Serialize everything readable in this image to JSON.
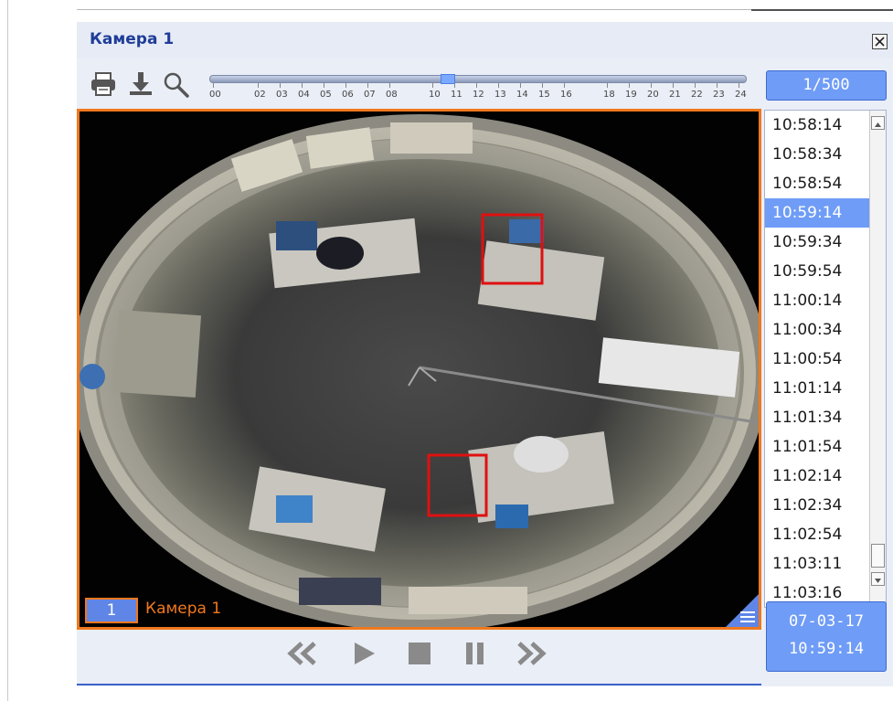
{
  "window": {
    "title": "Камера 1",
    "close_icon": "close-icon"
  },
  "toolbar": {
    "icons": [
      "print-icon",
      "download-icon",
      "search-icon"
    ],
    "counter": "1/500"
  },
  "timeline": {
    "ticks": [
      "00",
      "02",
      "03",
      "04",
      "05",
      "06",
      "07",
      "08",
      "10",
      "11",
      "12",
      "13",
      "14",
      "15",
      "16",
      "18",
      "19",
      "20",
      "21",
      "22",
      "23",
      "24"
    ],
    "position_fraction": 0.45
  },
  "camera": {
    "number": "1",
    "label": "Камера 1"
  },
  "time_list": {
    "items": [
      "10:58:14",
      "10:58:34",
      "10:58:54",
      "10:59:14",
      "10:59:34",
      "10:59:54",
      "11:00:14",
      "11:00:34",
      "11:00:54",
      "11:01:14",
      "11:01:34",
      "11:01:54",
      "11:02:14",
      "11:02:34",
      "11:02:54",
      "11:03:11",
      "11:03:16"
    ],
    "selected": "10:59:14"
  },
  "datetime": {
    "date": "07-03-17",
    "time": "10:59:14"
  },
  "playback": {
    "icons": [
      "rewind-icon",
      "play-icon",
      "stop-icon",
      "pause-icon",
      "fast-forward-icon"
    ]
  },
  "colors": {
    "accent": "#6f9cf6",
    "frame": "#f0781e",
    "title": "#1f3d99",
    "detection": "#e01010"
  }
}
